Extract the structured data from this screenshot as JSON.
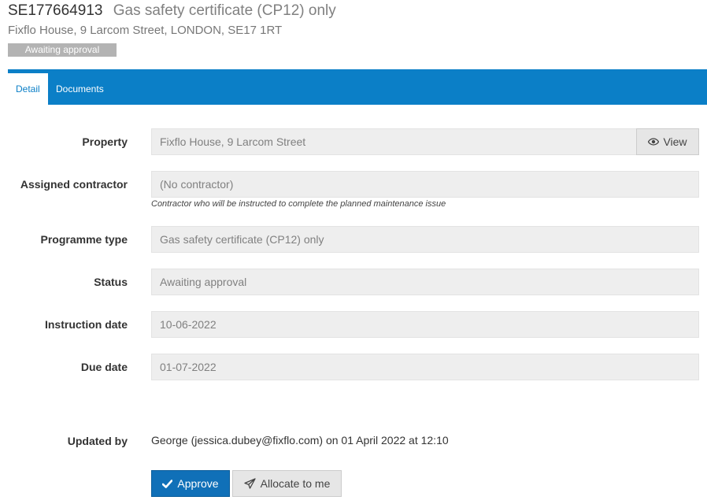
{
  "header": {
    "reference": "SE177664913",
    "programme_title": "Gas safety certificate (CP12) only",
    "address": "Fixflo House, 9 Larcom Street, LONDON, SE17 1RT",
    "status_badge": "Awaiting approval"
  },
  "tabs": [
    {
      "label": "Detail",
      "active": true
    },
    {
      "label": "Documents",
      "active": false
    }
  ],
  "form": {
    "property": {
      "label": "Property",
      "value": "Fixflo House, 9 Larcom Street",
      "view_label": "View"
    },
    "assigned_contractor": {
      "label": "Assigned contractor",
      "value": "(No contractor)",
      "help": "Contractor who will be instructed to complete the planned maintenance issue"
    },
    "programme_type": {
      "label": "Programme type",
      "value": "Gas safety certificate (CP12) only"
    },
    "status": {
      "label": "Status",
      "value": "Awaiting approval"
    },
    "instruction_date": {
      "label": "Instruction date",
      "value": "10-06-2022"
    },
    "due_date": {
      "label": "Due date",
      "value": "01-07-2022"
    },
    "updated_by": {
      "label": "Updated by",
      "value": "George (jessica.dubey@fixflo.com) on 01 April 2022 at 12:10"
    }
  },
  "actions": {
    "approve_label": "Approve",
    "allocate_label": "Allocate to me"
  },
  "colors": {
    "tab_bar": "#0b7fc7",
    "approve_button": "#1070b8",
    "badge": "#b3b3b3"
  },
  "icons": {
    "view": "eye-icon",
    "approve": "check-icon",
    "allocate": "paper-plane-icon"
  }
}
